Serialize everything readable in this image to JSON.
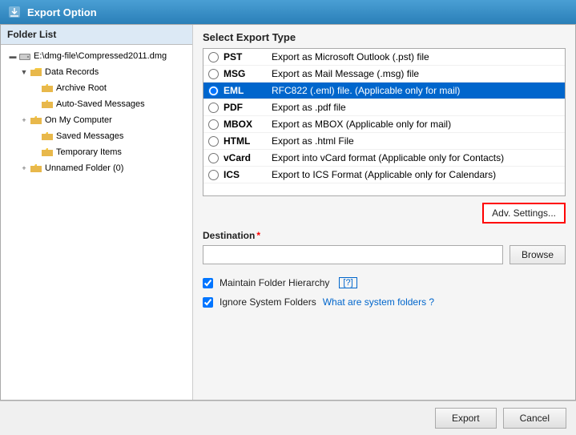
{
  "titleBar": {
    "icon": "export-icon",
    "title": "Export Option"
  },
  "leftPanel": {
    "header": "Folder List",
    "tree": [
      {
        "id": "root-drive",
        "label": "E:\\dmg-file\\Compressed2011.dmg",
        "indent": 0,
        "toggle": "-",
        "icon": "drive",
        "expanded": true
      },
      {
        "id": "data-records",
        "label": "Data Records",
        "indent": 1,
        "toggle": "-",
        "icon": "folder",
        "expanded": true
      },
      {
        "id": "archive-root",
        "label": "Archive Root",
        "indent": 2,
        "toggle": "",
        "icon": "folder",
        "expanded": false
      },
      {
        "id": "auto-saved",
        "label": "Auto-Saved Messages",
        "indent": 2,
        "toggle": "",
        "icon": "folder",
        "expanded": false
      },
      {
        "id": "on-my-computer",
        "label": "On My Computer",
        "indent": 2,
        "toggle": "+",
        "icon": "folder",
        "expanded": false
      },
      {
        "id": "saved-messages",
        "label": "Saved Messages",
        "indent": 2,
        "toggle": "",
        "icon": "folder",
        "expanded": false
      },
      {
        "id": "temporary-items",
        "label": "Temporary Items",
        "indent": 2,
        "toggle": "",
        "icon": "folder",
        "expanded": false
      },
      {
        "id": "unnamed-folder",
        "label": "Unnamed Folder (0)",
        "indent": 2,
        "toggle": "+",
        "icon": "folder",
        "expanded": false
      }
    ]
  },
  "rightPanel": {
    "header": "Select Export Type",
    "exportTypes": [
      {
        "id": "pst",
        "name": "PST",
        "description": "Export as Microsoft Outlook (.pst) file",
        "selected": false
      },
      {
        "id": "msg",
        "name": "MSG",
        "description": "Export as Mail Message (.msg) file",
        "selected": false
      },
      {
        "id": "eml",
        "name": "EML",
        "description": "RFC822 (.eml) file. (Applicable only for mail)",
        "selected": true
      },
      {
        "id": "pdf",
        "name": "PDF",
        "description": "Export as .pdf file",
        "selected": false
      },
      {
        "id": "mbox",
        "name": "MBOX",
        "description": "Export as MBOX (Applicable only for mail)",
        "selected": false
      },
      {
        "id": "html",
        "name": "HTML",
        "description": "Export as .html File",
        "selected": false
      },
      {
        "id": "vcard",
        "name": "vCard",
        "description": "Export into vCard format (Applicable only for Contacts)",
        "selected": false
      },
      {
        "id": "ics",
        "name": "ICS",
        "description": "Export to ICS Format (Applicable only for Calendars)",
        "selected": false
      }
    ],
    "advSettingsLabel": "Adv. Settings...",
    "destinationLabel": "Destination",
    "destinationRequired": "*",
    "destinationPlaceholder": "",
    "browseLabel": "Browse",
    "options": [
      {
        "id": "maintain-hierarchy",
        "label": "Maintain Folder Hierarchy",
        "helpText": "[?]",
        "checked": true,
        "link": null
      },
      {
        "id": "ignore-system",
        "label": "Ignore System Folders",
        "helpText": null,
        "checked": true,
        "link": "What are system folders ?"
      }
    ],
    "exportLabel": "Export",
    "cancelLabel": "Cancel"
  }
}
